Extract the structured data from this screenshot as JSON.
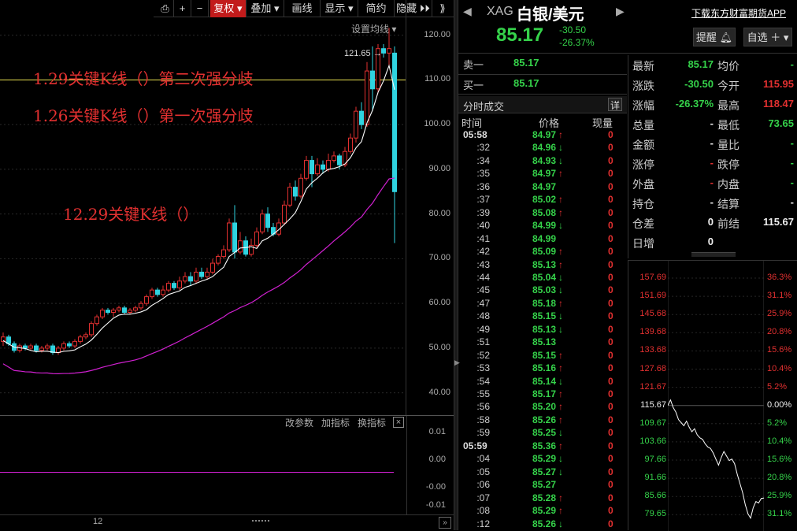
{
  "toolbar": {
    "buttons": [
      "复权",
      "叠加",
      "画线",
      "显示",
      "简约",
      "隐藏"
    ],
    "active": "复权"
  },
  "chart_settings_label": "设置均线",
  "indicator_controls": [
    "改参数",
    "加指标",
    "换指标"
  ],
  "annotations": [
    "1.29关键K线（）第二次强分歧",
    "1.26关键K线（）第一次强分歧",
    "12.29关键K线（）"
  ],
  "price_axis_ticks": [
    "120.00",
    "110.00",
    "100.00",
    "90.00",
    "80.00",
    "70.00",
    "60.00",
    "50.00",
    "40.00"
  ],
  "indicator_axis_ticks": [
    "0.01",
    "0.00",
    "-0.00",
    "-0.01"
  ],
  "high_marker": "121.65",
  "date_label": "12",
  "colors": {
    "up": "#e23030",
    "down": "#2fd3e0",
    "ma_short": "#ffffff",
    "ma_long": "#d020d0",
    "level_line": "#e8e050",
    "green": "#35d24a"
  },
  "chart_data": {
    "type": "candlestick",
    "y_range": [
      35,
      124
    ],
    "level_line": 110,
    "candles": [
      [
        51.5,
        52.5,
        50.5,
        53.5
      ],
      [
        52.5,
        51.0,
        50.5,
        53.0
      ],
      [
        51.0,
        49.5,
        49.0,
        51.5
      ],
      [
        49.5,
        50.5,
        49.0,
        51.0
      ],
      [
        50.5,
        50.0,
        49.5,
        51.0
      ],
      [
        50.0,
        50.5,
        49.5,
        51.0
      ],
      [
        50.5,
        49.5,
        49.0,
        51.0
      ],
      [
        49.5,
        50.0,
        49.0,
        50.5
      ],
      [
        50.0,
        50.5,
        49.5,
        51.0
      ],
      [
        50.5,
        49.0,
        48.5,
        51.0
      ],
      [
        49.0,
        50.0,
        48.5,
        50.5
      ],
      [
        50.0,
        51.0,
        49.5,
        51.5
      ],
      [
        51.0,
        50.5,
        50.0,
        51.5
      ],
      [
        50.5,
        51.5,
        50.0,
        52.0
      ],
      [
        51.5,
        52.5,
        51.0,
        53.0
      ],
      [
        52.5,
        53.0,
        52.0,
        53.5
      ],
      [
        53.0,
        55.5,
        52.5,
        56.0
      ],
      [
        55.5,
        57.0,
        55.0,
        57.5
      ],
      [
        57.0,
        58.5,
        56.5,
        59.0
      ],
      [
        58.5,
        58.0,
        57.5,
        59.0
      ],
      [
        58.0,
        58.5,
        57.0,
        59.0
      ],
      [
        58.5,
        59.0,
        58.0,
        59.5
      ],
      [
        59.0,
        58.0,
        57.5,
        59.5
      ],
      [
        58.0,
        58.5,
        57.5,
        59.0
      ],
      [
        58.5,
        59.0,
        58.0,
        59.5
      ],
      [
        59.0,
        60.0,
        58.5,
        60.5
      ],
      [
        60.0,
        61.5,
        59.5,
        62.0
      ],
      [
        61.5,
        63.0,
        61.0,
        63.5
      ],
      [
        63.0,
        62.0,
        61.5,
        63.5
      ],
      [
        62.0,
        63.0,
        61.5,
        64.0
      ],
      [
        63.0,
        64.5,
        62.5,
        65.0
      ],
      [
        64.5,
        63.5,
        63.0,
        65.0
      ],
      [
        63.5,
        65.0,
        63.0,
        66.0
      ],
      [
        65.0,
        66.0,
        64.5,
        67.0
      ],
      [
        66.0,
        65.0,
        64.0,
        67.0
      ],
      [
        65.0,
        67.0,
        64.5,
        68.0
      ],
      [
        67.0,
        66.0,
        65.5,
        68.0
      ],
      [
        66.0,
        67.0,
        65.5,
        68.0
      ],
      [
        67.0,
        69.0,
        66.5,
        70.0
      ],
      [
        69.0,
        70.5,
        68.5,
        71.0
      ],
      [
        70.5,
        72.0,
        70.0,
        73.0
      ],
      [
        72.0,
        78.0,
        71.5,
        79.0
      ],
      [
        78.0,
        71.5,
        70.0,
        82.0
      ],
      [
        71.5,
        74.0,
        71.0,
        76.0
      ],
      [
        74.0,
        71.0,
        70.5,
        75.0
      ],
      [
        71.0,
        73.0,
        70.5,
        74.5
      ],
      [
        73.0,
        76.0,
        72.5,
        77.0
      ],
      [
        76.0,
        80.0,
        75.5,
        81.0
      ],
      [
        80.0,
        77.0,
        76.0,
        81.5
      ],
      [
        77.0,
        75.5,
        75.0,
        78.0
      ],
      [
        75.5,
        78.0,
        75.0,
        79.0
      ],
      [
        78.0,
        82.0,
        77.5,
        83.0
      ],
      [
        82.0,
        86.0,
        81.5,
        87.0
      ],
      [
        86.0,
        84.0,
        83.0,
        87.5
      ],
      [
        84.0,
        88.0,
        83.5,
        89.0
      ],
      [
        88.0,
        92.0,
        87.5,
        93.0
      ],
      [
        92.0,
        89.0,
        86.0,
        93.0
      ],
      [
        89.0,
        91.0,
        88.5,
        92.5
      ],
      [
        91.0,
        90.0,
        89.0,
        92.0
      ],
      [
        90.0,
        92.0,
        89.5,
        93.5
      ],
      [
        92.0,
        93.0,
        91.5,
        94.0
      ],
      [
        93.0,
        91.0,
        90.0,
        93.5
      ],
      [
        91.0,
        94.0,
        90.5,
        95.0
      ],
      [
        94.0,
        97.0,
        93.5,
        98.0
      ],
      [
        97.0,
        103.0,
        96.0,
        104.0
      ],
      [
        103.0,
        100.0,
        99.0,
        105.0
      ],
      [
        100.0,
        112.0,
        99.5,
        114.0
      ],
      [
        112.0,
        108.0,
        103.0,
        117.5
      ],
      [
        108.0,
        117.0,
        107.0,
        118.0
      ],
      [
        117.0,
        116.0,
        115.0,
        118.0
      ],
      [
        116.0,
        117.0,
        113.0,
        121.65
      ],
      [
        116.0,
        85.0,
        73.5,
        117.5
      ]
    ]
  },
  "header": {
    "code": "XAG",
    "name": "白银/美元",
    "price": "85.17",
    "change": "-30.50",
    "change_pct": "-26.37%",
    "download_link": "下载东方财富期货APP",
    "remind_btn": "提醒",
    "watchlist_btn": "自选"
  },
  "orderbook": {
    "sell_label": "卖一",
    "sell_value": "85.17",
    "buy_label": "买一",
    "buy_value": "85.17"
  },
  "trades_panel": {
    "title": "分时成交",
    "detail_btn": "详",
    "col_time": "时间",
    "col_price": "价格",
    "col_vol": "现量",
    "rows": [
      {
        "t": "05:58",
        "p": "84.97",
        "d": "up",
        "v": "0",
        "full": true
      },
      {
        "t": ":32",
        "p": "84.96",
        "d": "down",
        "v": "0"
      },
      {
        "t": ":34",
        "p": "84.93",
        "d": "down",
        "v": "0"
      },
      {
        "t": ":35",
        "p": "84.97",
        "d": "up",
        "v": "0"
      },
      {
        "t": ":36",
        "p": "84.97",
        "d": "",
        "v": "0"
      },
      {
        "t": ":37",
        "p": "85.02",
        "d": "up",
        "v": "0"
      },
      {
        "t": ":39",
        "p": "85.08",
        "d": "up",
        "v": "0"
      },
      {
        "t": ":40",
        "p": "84.99",
        "d": "down",
        "v": "0"
      },
      {
        "t": ":41",
        "p": "84.99",
        "d": "",
        "v": "0"
      },
      {
        "t": ":42",
        "p": "85.09",
        "d": "up",
        "v": "0"
      },
      {
        "t": ":43",
        "p": "85.13",
        "d": "up",
        "v": "0"
      },
      {
        "t": ":44",
        "p": "85.04",
        "d": "down",
        "v": "0"
      },
      {
        "t": ":45",
        "p": "85.03",
        "d": "down",
        "v": "0"
      },
      {
        "t": ":47",
        "p": "85.18",
        "d": "up",
        "v": "0"
      },
      {
        "t": ":48",
        "p": "85.15",
        "d": "down",
        "v": "0"
      },
      {
        "t": ":49",
        "p": "85.13",
        "d": "down",
        "v": "0"
      },
      {
        "t": ":51",
        "p": "85.13",
        "d": "",
        "v": "0"
      },
      {
        "t": ":52",
        "p": "85.15",
        "d": "up",
        "v": "0"
      },
      {
        "t": ":53",
        "p": "85.16",
        "d": "up",
        "v": "0"
      },
      {
        "t": ":54",
        "p": "85.14",
        "d": "down",
        "v": "0"
      },
      {
        "t": ":55",
        "p": "85.17",
        "d": "up",
        "v": "0"
      },
      {
        "t": ":56",
        "p": "85.20",
        "d": "up",
        "v": "0"
      },
      {
        "t": ":58",
        "p": "85.26",
        "d": "up",
        "v": "0"
      },
      {
        "t": ":59",
        "p": "85.25",
        "d": "down",
        "v": "0"
      },
      {
        "t": "05:59",
        "p": "85.36",
        "d": "up",
        "v": "0",
        "full": true
      },
      {
        "t": ":04",
        "p": "85.29",
        "d": "down",
        "v": "0"
      },
      {
        "t": ":05",
        "p": "85.27",
        "d": "down",
        "v": "0"
      },
      {
        "t": ":06",
        "p": "85.27",
        "d": "",
        "v": "0"
      },
      {
        "t": ":07",
        "p": "85.28",
        "d": "up",
        "v": "0"
      },
      {
        "t": ":08",
        "p": "85.29",
        "d": "up",
        "v": "0"
      },
      {
        "t": ":12",
        "p": "85.26",
        "d": "down",
        "v": "0"
      }
    ]
  },
  "quote": {
    "rows": [
      {
        "l1": "最新",
        "v1": "85.17",
        "c1": "green",
        "l2": "均价",
        "v2": "-",
        "c2": "green"
      },
      {
        "l1": "涨跌",
        "v1": "-30.50",
        "c1": "green",
        "l2": "今开",
        "v2": "115.95",
        "c2": "red"
      },
      {
        "l1": "涨幅",
        "v1": "-26.37%",
        "c1": "green",
        "l2": "最高",
        "v2": "118.47",
        "c2": "red"
      },
      {
        "l1": "总量",
        "v1": "-",
        "c1": "white",
        "l2": "最低",
        "v2": "73.65",
        "c2": "green"
      },
      {
        "l1": "金额",
        "v1": "-",
        "c1": "white",
        "l2": "量比",
        "v2": "-",
        "c2": "green"
      },
      {
        "l1": "涨停",
        "v1": "-",
        "c1": "red",
        "l2": "跌停",
        "v2": "-",
        "c2": "green"
      },
      {
        "l1": "外盘",
        "v1": "-",
        "c1": "red",
        "l2": "内盘",
        "v2": "-",
        "c2": "green"
      },
      {
        "l1": "持仓",
        "v1": "-",
        "c1": "white",
        "l2": "结算",
        "v2": "-",
        "c2": "white"
      },
      {
        "l1": "仓差",
        "v1": "0",
        "c1": "white",
        "l2": "前结",
        "v2": "115.67",
        "c2": "white"
      },
      {
        "l1": "日增",
        "v1": "0",
        "c1": "white",
        "l2": "",
        "v2": "",
        "c2": "white"
      }
    ]
  },
  "intraday": {
    "left_ticks": [
      "157.69",
      "151.69",
      "145.68",
      "139.68",
      "133.68",
      "127.68",
      "121.67",
      "115.67",
      "109.67",
      "103.66",
      "97.66",
      "91.66",
      "85.66",
      "79.65"
    ],
    "right_ticks": [
      "36.3%",
      "31.1%",
      "25.9%",
      "20.8%",
      "15.6%",
      "10.4%",
      "5.2%",
      "0.00%",
      "5.2%",
      "10.4%",
      "15.6%",
      "20.8%",
      "25.9%",
      "31.1%"
    ],
    "prices": [
      115.67,
      117.5,
      115.0,
      113.5,
      111.0,
      110.0,
      109.0,
      110.5,
      108.5,
      107.0,
      108.0,
      106.0,
      105.0,
      104.5,
      103.0,
      102.0,
      101.5,
      100.0,
      98.0,
      96.0,
      98.5,
      100.5,
      99.0,
      97.5,
      98.0,
      96.5,
      93.0,
      90.0,
      87.0,
      83.0,
      80.0,
      78.5,
      82.0,
      84.0,
      83.5,
      85.0,
      85.17
    ]
  }
}
